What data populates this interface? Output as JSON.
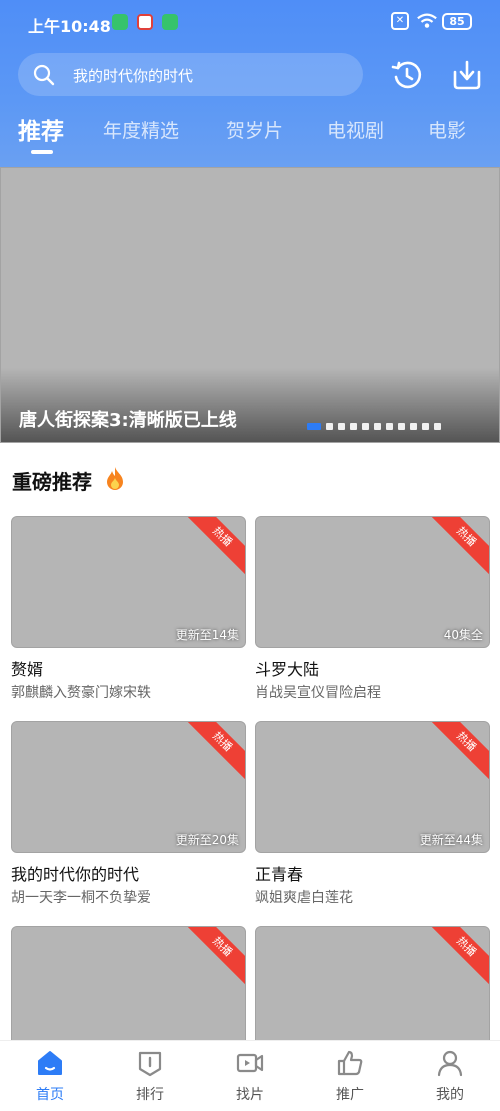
{
  "status": {
    "time": "上午10:48",
    "battery": "85"
  },
  "search": {
    "placeholder": "我的时代你的时代"
  },
  "tabs": [
    {
      "label": "推荐",
      "active": true
    },
    {
      "label": "年度精选"
    },
    {
      "label": "贺岁片"
    },
    {
      "label": "电视剧"
    },
    {
      "label": "电影"
    }
  ],
  "banner": {
    "caption": "唐人街探案3:清晰版已上线",
    "dot_count": 11,
    "active_dot": 0
  },
  "section": {
    "title": "重磅推荐"
  },
  "cards": [
    {
      "title": "赘婿",
      "subtitle": "郭麒麟入赘豪门嫁宋轶",
      "badge": "热播",
      "episode": "更新至14集"
    },
    {
      "title": "斗罗大陆",
      "subtitle": "肖战吴宣仪冒险启程",
      "badge": "热播",
      "episode": "40集全"
    },
    {
      "title": "我的时代你的时代",
      "subtitle": "胡一天李一桐不负挚爱",
      "badge": "热播",
      "episode": "更新至20集"
    },
    {
      "title": "正青春",
      "subtitle": "飒姐爽虐白莲花",
      "badge": "热播",
      "episode": "更新至44集"
    },
    {
      "title": "",
      "subtitle": "",
      "badge": "热播",
      "episode": ""
    },
    {
      "title": "",
      "subtitle": "",
      "badge": "热播",
      "episode": ""
    }
  ],
  "nav": [
    {
      "label": "首页",
      "icon": "home-icon",
      "active": true
    },
    {
      "label": "排行",
      "icon": "ranking-icon"
    },
    {
      "label": "找片",
      "icon": "video-camera-icon"
    },
    {
      "label": "推广",
      "icon": "thumbs-up-icon"
    },
    {
      "label": "我的",
      "icon": "profile-icon"
    }
  ],
  "colors": {
    "accent": "#2d7cf6",
    "header": "#4f8ef7",
    "badge": "#ee4035"
  }
}
